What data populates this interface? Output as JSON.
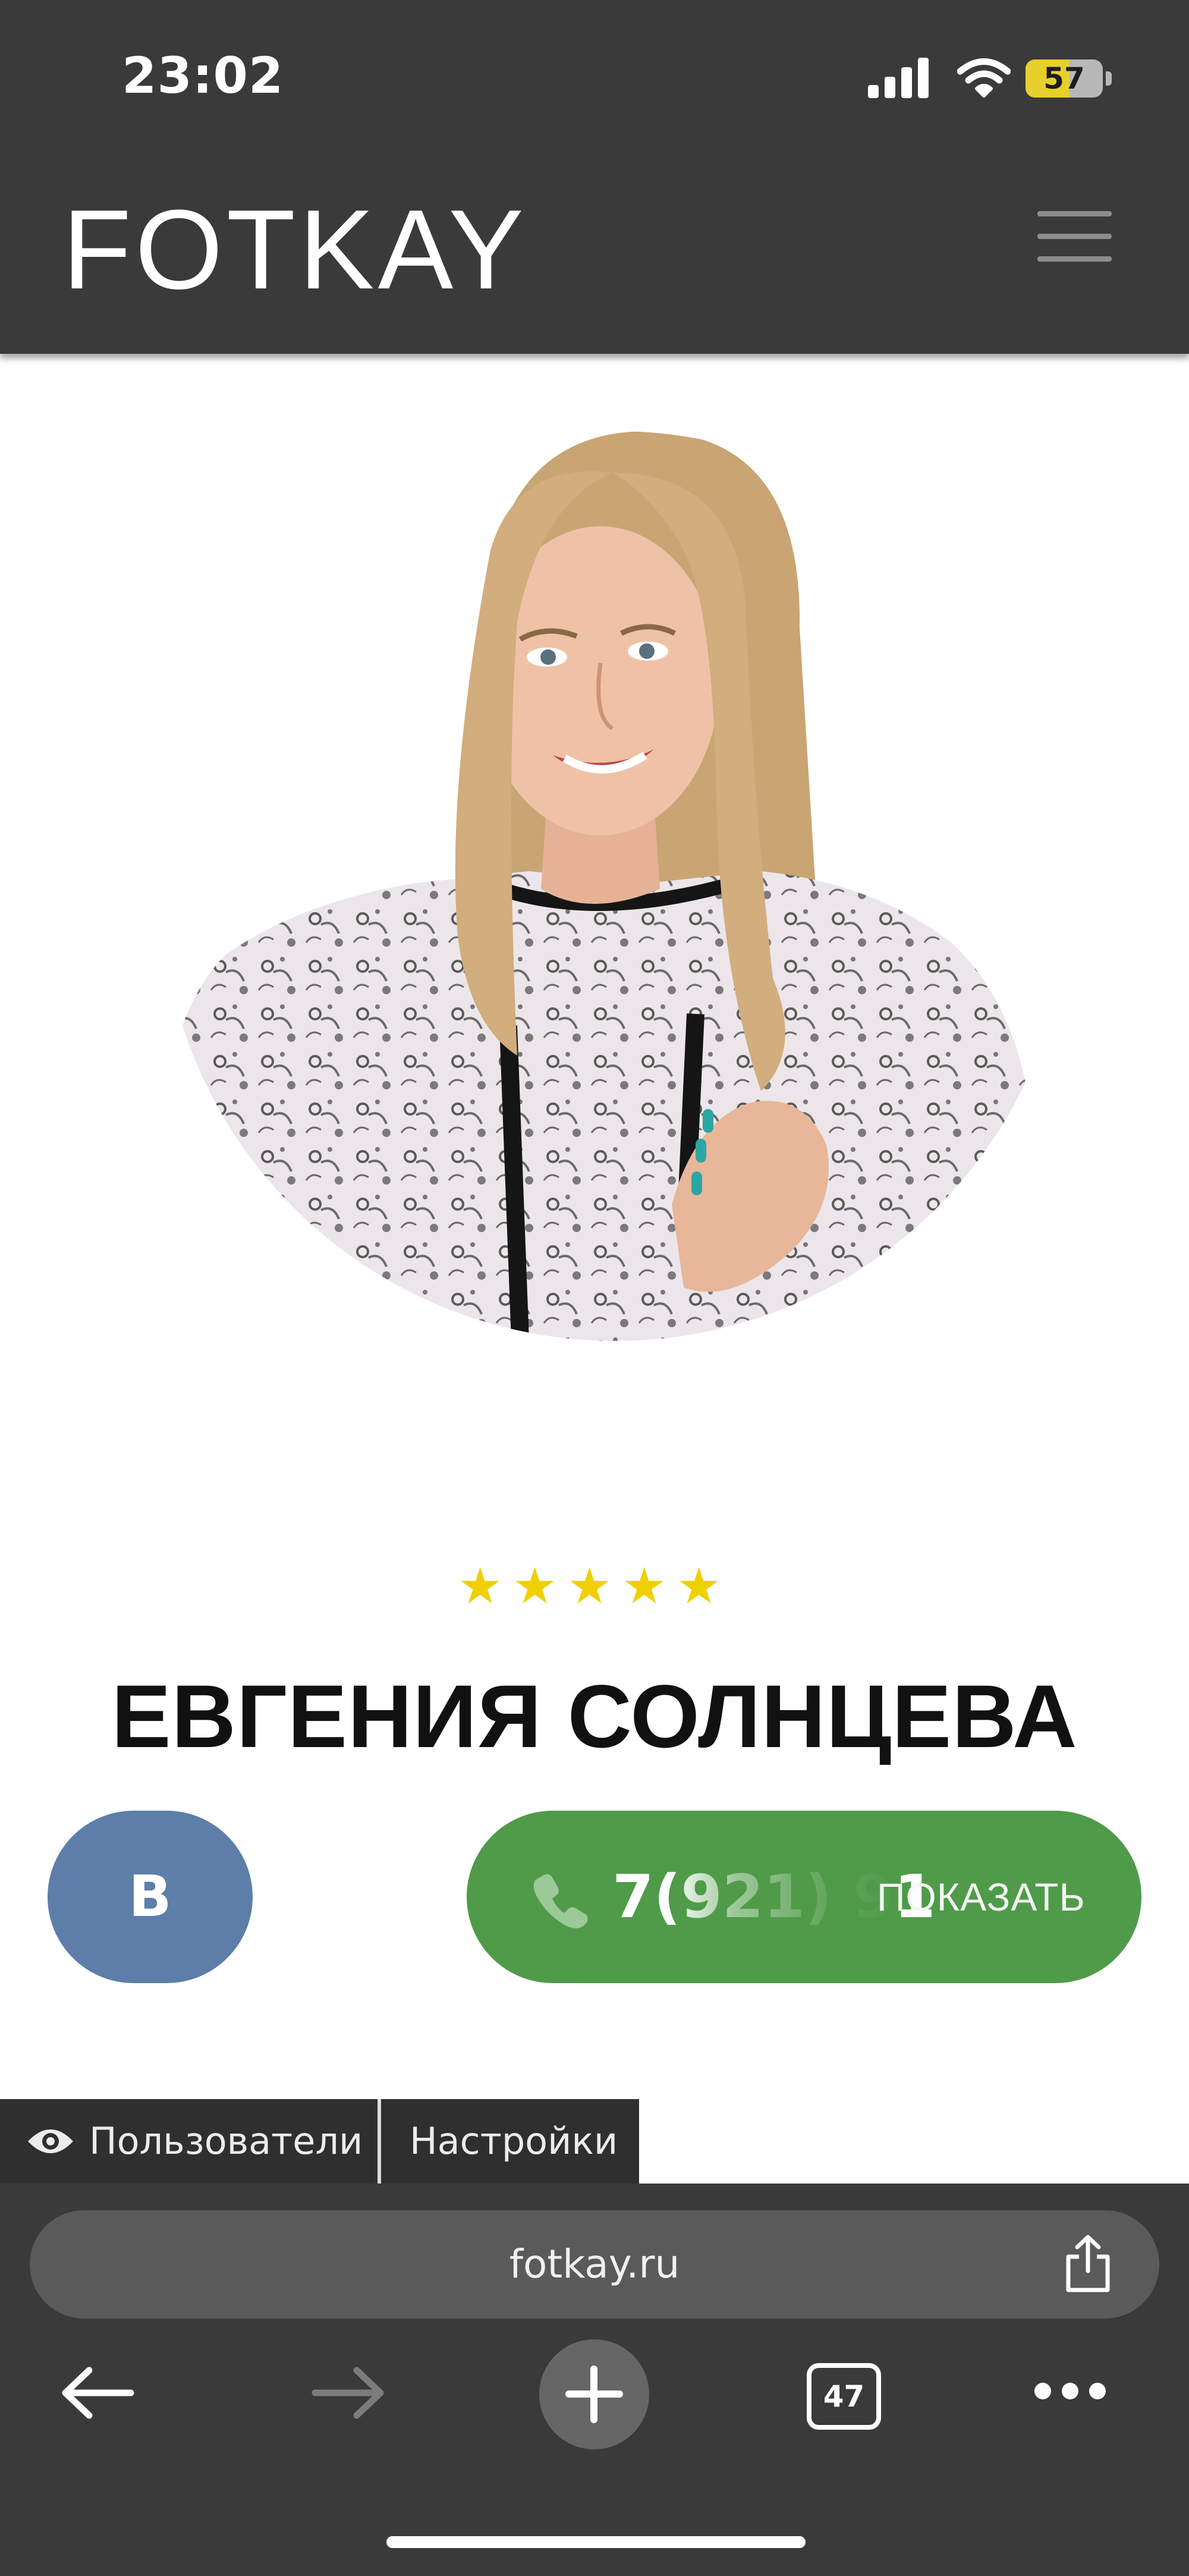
{
  "status_bar": {
    "time": "23:02",
    "battery_level": "57",
    "battery_fraction": 0.57,
    "battery_color": "#e7cf2d",
    "icons": [
      "signal-icon",
      "wifi-icon",
      "battery-icon"
    ]
  },
  "header": {
    "logo": "FOTKAY",
    "menu_icon": "hamburger-menu-icon",
    "background": "#3a3a3a"
  },
  "profile": {
    "photo_description_icon": "profile-photo",
    "rating_stars": 5,
    "rating_max": 5,
    "star_glyph": "★",
    "name": "ЕВГЕНИЯ СОЛНЦЕВА"
  },
  "actions": {
    "vk_label": "В",
    "vk_color": "#5c7ea9",
    "phone_number_partial": "7(921) 91",
    "phone_show_label": "ПОКАЗАТЬ",
    "phone_color": "#4f9b49",
    "phone_icon": "phone-icon"
  },
  "admin_tabs": {
    "users_label": "Пользователи",
    "users_icon": "eye-icon",
    "settings_label": "Настройки"
  },
  "browser": {
    "url": "fotkay.ru",
    "tabs_count": "47",
    "icons": [
      "share-icon",
      "back-arrow-icon",
      "forward-arrow-icon",
      "plus-icon",
      "tabs-icon",
      "more-dots-icon"
    ]
  }
}
